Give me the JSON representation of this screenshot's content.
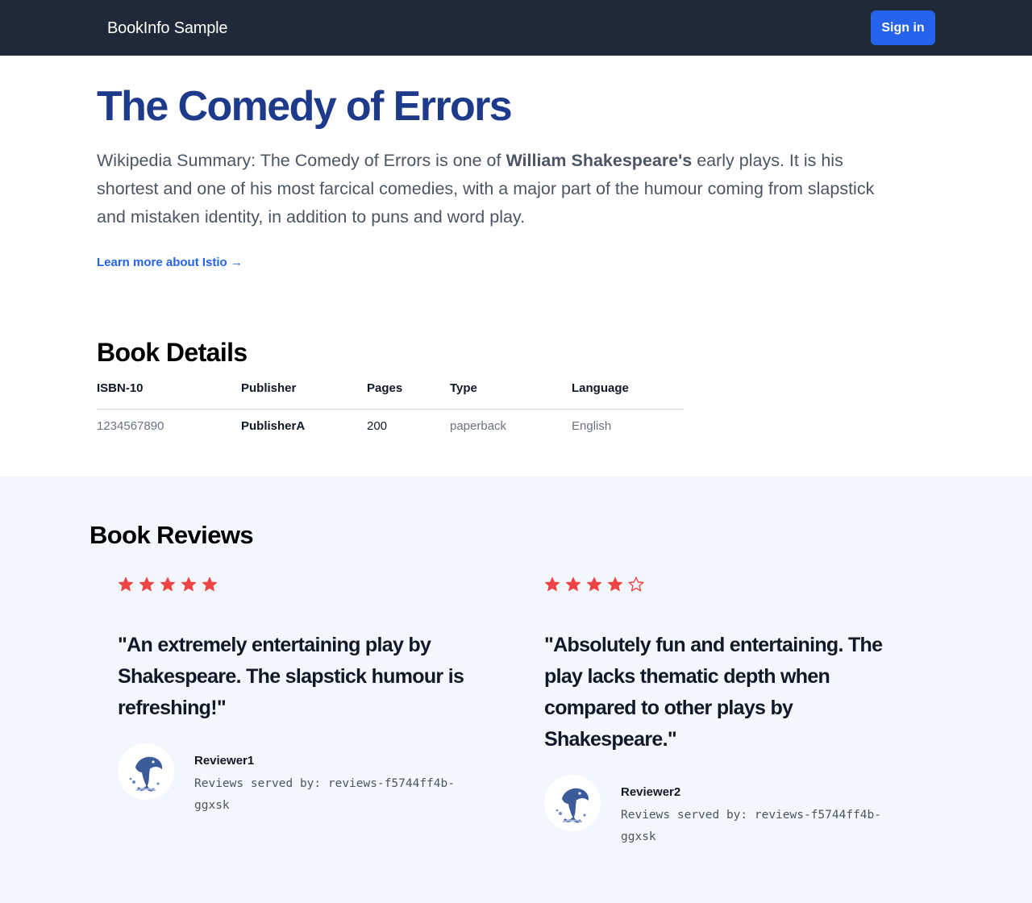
{
  "nav": {
    "brand": "BookInfo Sample",
    "signin_label": "Sign in"
  },
  "book": {
    "title": "The Comedy of Errors",
    "summary_prefix": "Wikipedia Summary: The Comedy of Errors is one of ",
    "summary_bold": "William Shakespeare's",
    "summary_suffix": " early plays. It is his shortest and one of his most farcical comedies, with a major part of the humour coming from slapstick and mistaken identity, in addition to puns and word play.",
    "learn_more": "Learn more about Istio →"
  },
  "details": {
    "heading": "Book Details",
    "columns": [
      "ISBN-10",
      "Publisher",
      "Pages",
      "Type",
      "Language"
    ],
    "row": [
      "1234567890",
      "PublisherA",
      "200",
      "paperback",
      "English"
    ]
  },
  "reviews": {
    "heading": "Book Reviews",
    "items": [
      {
        "rating": 5,
        "max_rating": 5,
        "text": "\"An extremely entertaining play by Shakespeare. The slapstick humour is refreshing!\"",
        "reviewer": "Reviewer1",
        "served_by": "Reviews served by: reviews-f5744ff4b-ggxsk",
        "avatar_icon": "dolphin-icon"
      },
      {
        "rating": 4,
        "max_rating": 5,
        "text": "\"Absolutely fun and entertaining. The play lacks thematic depth when compared to other plays by Shakespeare.\"",
        "reviewer": "Reviewer2",
        "served_by": "Reviews served by: reviews-f5744ff4b-ggxsk",
        "avatar_icon": "dolphin-icon"
      }
    ]
  },
  "colors": {
    "navbar": "#1f2937",
    "accent": "#2563eb",
    "title": "#1e3a8a",
    "star": "#ef4444",
    "reviews_bg": "#f3f6fc"
  }
}
